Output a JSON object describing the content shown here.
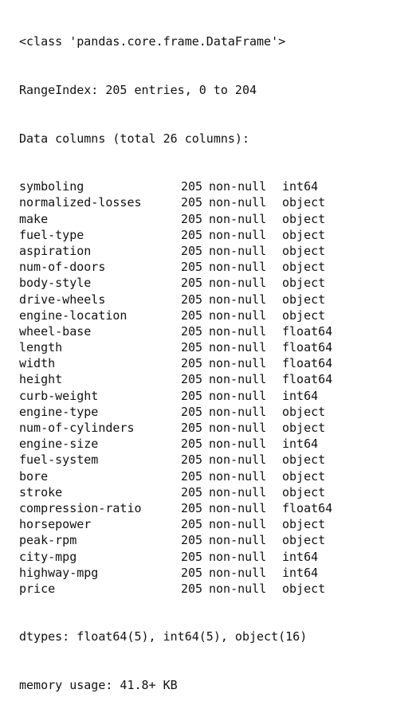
{
  "header": {
    "class_line": "<class 'pandas.core.frame.DataFrame'>",
    "range_index": "RangeIndex: 205 entries, 0 to 204",
    "data_columns": "Data columns (total 26 columns):"
  },
  "columns": [
    {
      "name": "symboling",
      "count": "205",
      "nonnull": "non-null",
      "dtype": "int64"
    },
    {
      "name": "normalized-losses",
      "count": "205",
      "nonnull": "non-null",
      "dtype": "object"
    },
    {
      "name": "make",
      "count": "205",
      "nonnull": "non-null",
      "dtype": "object"
    },
    {
      "name": "fuel-type",
      "count": "205",
      "nonnull": "non-null",
      "dtype": "object"
    },
    {
      "name": "aspiration",
      "count": "205",
      "nonnull": "non-null",
      "dtype": "object"
    },
    {
      "name": "num-of-doors",
      "count": "205",
      "nonnull": "non-null",
      "dtype": "object"
    },
    {
      "name": "body-style",
      "count": "205",
      "nonnull": "non-null",
      "dtype": "object"
    },
    {
      "name": "drive-wheels",
      "count": "205",
      "nonnull": "non-null",
      "dtype": "object"
    },
    {
      "name": "engine-location",
      "count": "205",
      "nonnull": "non-null",
      "dtype": "object"
    },
    {
      "name": "wheel-base",
      "count": "205",
      "nonnull": "non-null",
      "dtype": "float64"
    },
    {
      "name": "length",
      "count": "205",
      "nonnull": "non-null",
      "dtype": "float64"
    },
    {
      "name": "width",
      "count": "205",
      "nonnull": "non-null",
      "dtype": "float64"
    },
    {
      "name": "height",
      "count": "205",
      "nonnull": "non-null",
      "dtype": "float64"
    },
    {
      "name": "curb-weight",
      "count": "205",
      "nonnull": "non-null",
      "dtype": "int64"
    },
    {
      "name": "engine-type",
      "count": "205",
      "nonnull": "non-null",
      "dtype": "object"
    },
    {
      "name": "num-of-cylinders",
      "count": "205",
      "nonnull": "non-null",
      "dtype": "object"
    },
    {
      "name": "engine-size",
      "count": "205",
      "nonnull": "non-null",
      "dtype": "int64"
    },
    {
      "name": "fuel-system",
      "count": "205",
      "nonnull": "non-null",
      "dtype": "object"
    },
    {
      "name": "bore",
      "count": "205",
      "nonnull": "non-null",
      "dtype": "object"
    },
    {
      "name": "stroke",
      "count": "205",
      "nonnull": "non-null",
      "dtype": "object"
    },
    {
      "name": "compression-ratio",
      "count": "205",
      "nonnull": "non-null",
      "dtype": "float64"
    },
    {
      "name": "horsepower",
      "count": "205",
      "nonnull": "non-null",
      "dtype": "object"
    },
    {
      "name": "peak-rpm",
      "count": "205",
      "nonnull": "non-null",
      "dtype": "object"
    },
    {
      "name": "city-mpg",
      "count": "205",
      "nonnull": "non-null",
      "dtype": "int64"
    },
    {
      "name": "highway-mpg",
      "count": "205",
      "nonnull": "non-null",
      "dtype": "int64"
    },
    {
      "name": "price",
      "count": "205",
      "nonnull": "non-null",
      "dtype": "object"
    }
  ],
  "footer": {
    "dtypes": "dtypes: float64(5), int64(5), object(16)",
    "memory_usage": "memory usage: 41.8+ KB"
  }
}
